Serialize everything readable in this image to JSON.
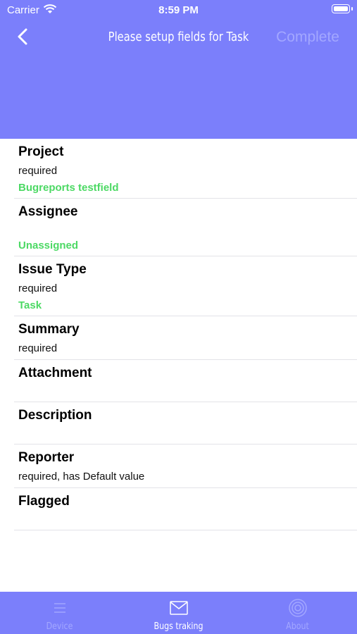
{
  "status_bar": {
    "carrier": "Carrier",
    "time": "8:59 PM"
  },
  "nav": {
    "title": "Please setup fields for Task",
    "complete_label": "Complete",
    "back_icon": "chevron-left-icon"
  },
  "fields": [
    {
      "name": "Project",
      "note": "required",
      "value": "Bugreports testfield"
    },
    {
      "name": "Assignee",
      "note": "",
      "value": "Unassigned"
    },
    {
      "name": "Issue Type",
      "note": "required",
      "value": "Task"
    },
    {
      "name": "Summary",
      "note": "required",
      "value": ""
    },
    {
      "name": "Attachment",
      "note": "",
      "value": ""
    },
    {
      "name": "Description",
      "note": "",
      "value": ""
    },
    {
      "name": "Reporter",
      "note": "required, has Default value",
      "value": ""
    },
    {
      "name": "Flagged",
      "note": "",
      "value": ""
    }
  ],
  "tabs": [
    {
      "label": "Device",
      "icon": "list-icon",
      "active": false
    },
    {
      "label": "Bugs traking",
      "icon": "envelope-icon",
      "active": true
    },
    {
      "label": "About",
      "icon": "target-icon",
      "active": false
    }
  ],
  "colors": {
    "accent": "#7b7ffb",
    "value_green": "#4cd964",
    "disabled": "#a3a7ff"
  }
}
